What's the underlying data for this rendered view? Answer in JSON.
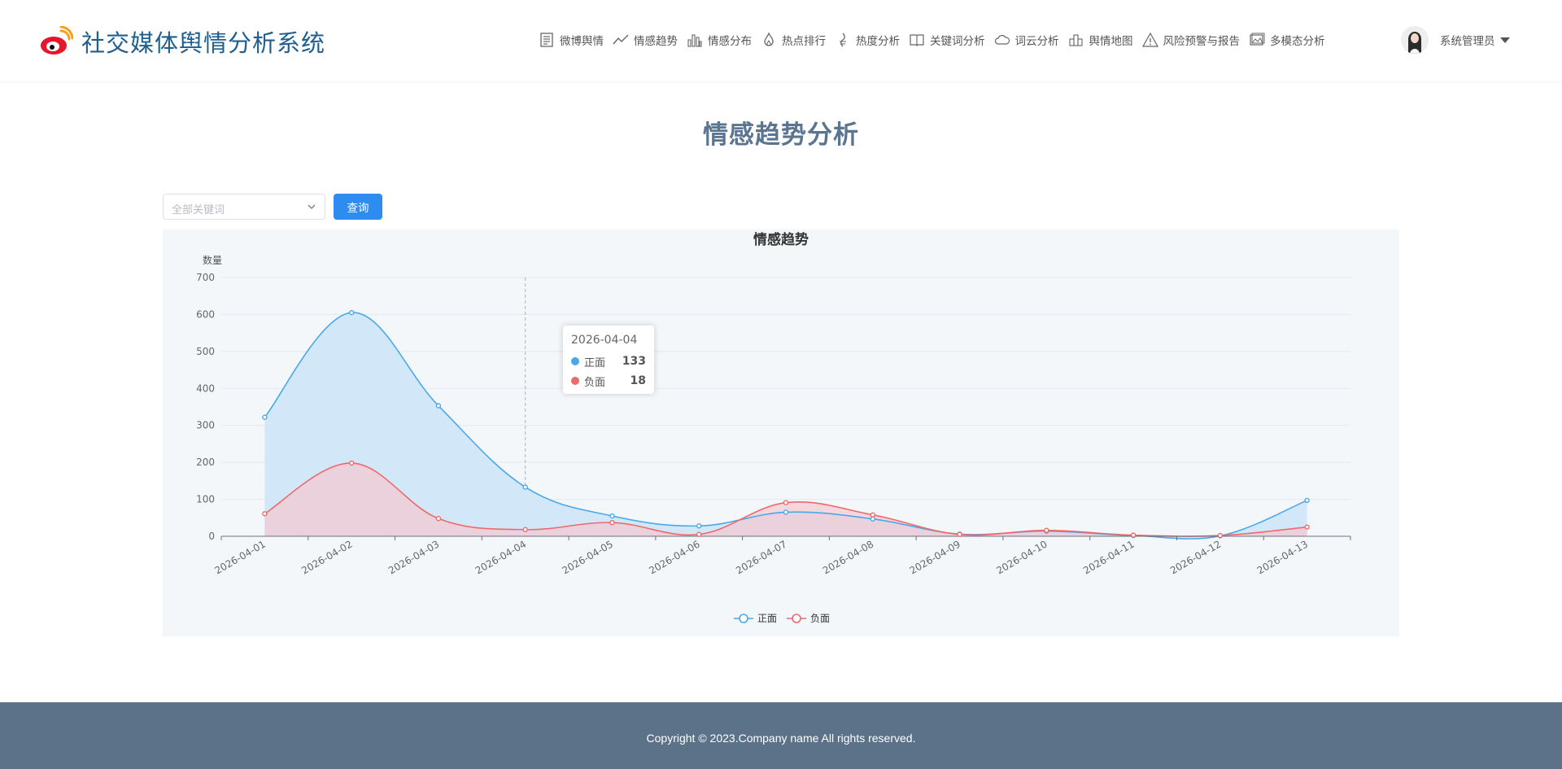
{
  "header": {
    "brand_title": "社交媒体舆情分析系统",
    "nav": [
      {
        "label": "微博舆情",
        "icon": "document-icon"
      },
      {
        "label": "情感趋势",
        "icon": "trend-line-icon"
      },
      {
        "label": "情感分布",
        "icon": "bar-chart-icon"
      },
      {
        "label": "热点排行",
        "icon": "flame-icon"
      },
      {
        "label": "热度分析",
        "icon": "heat-icon"
      },
      {
        "label": "关键词分析",
        "icon": "book-icon"
      },
      {
        "label": "词云分析",
        "icon": "cloud-icon"
      },
      {
        "label": "舆情地图",
        "icon": "map-icon"
      },
      {
        "label": "风险预警与报告",
        "icon": "warning-icon"
      },
      {
        "label": "多模态分析",
        "icon": "image-icon"
      }
    ],
    "user_name": "系统管理员"
  },
  "page_title": "情感趋势分析",
  "filter": {
    "placeholder": "全部关键词",
    "query_label": "查询"
  },
  "tooltip": {
    "date": "2026-04-04",
    "rows": [
      {
        "name": "正面",
        "value": "133"
      },
      {
        "name": "负面",
        "value": "18"
      }
    ]
  },
  "chart_data": {
    "type": "area",
    "title": "情感趋势",
    "ylabel": "数量",
    "xlabel": "",
    "ylim": [
      0,
      700
    ],
    "yticks": [
      0,
      100,
      200,
      300,
      400,
      500,
      600,
      700
    ],
    "grid": true,
    "legend_position": "bottom-center",
    "categories": [
      "2026-04-01",
      "2026-04-02",
      "2026-04-03",
      "2026-04-04",
      "2026-04-05",
      "2026-04-06",
      "2026-04-07",
      "2026-04-08",
      "2026-04-09",
      "2026-04-10",
      "2026-04-11",
      "2026-04-12",
      "2026-04-13"
    ],
    "series": [
      {
        "name": "正面",
        "color": "#4aa8ea",
        "fill": "#d2e8f9",
        "values": [
          322,
          605,
          353,
          133,
          55,
          28,
          65,
          47,
          6,
          14,
          2,
          1,
          97
        ]
      },
      {
        "name": "负面",
        "color": "#ee6a6a",
        "fill": "#f3c8d0",
        "values": [
          61,
          198,
          48,
          18,
          37,
          5,
          91,
          58,
          5,
          16,
          3,
          2,
          25
        ]
      }
    ]
  },
  "footer": {
    "copyright": "Copyright © 2023.Company name All rights reserved."
  }
}
